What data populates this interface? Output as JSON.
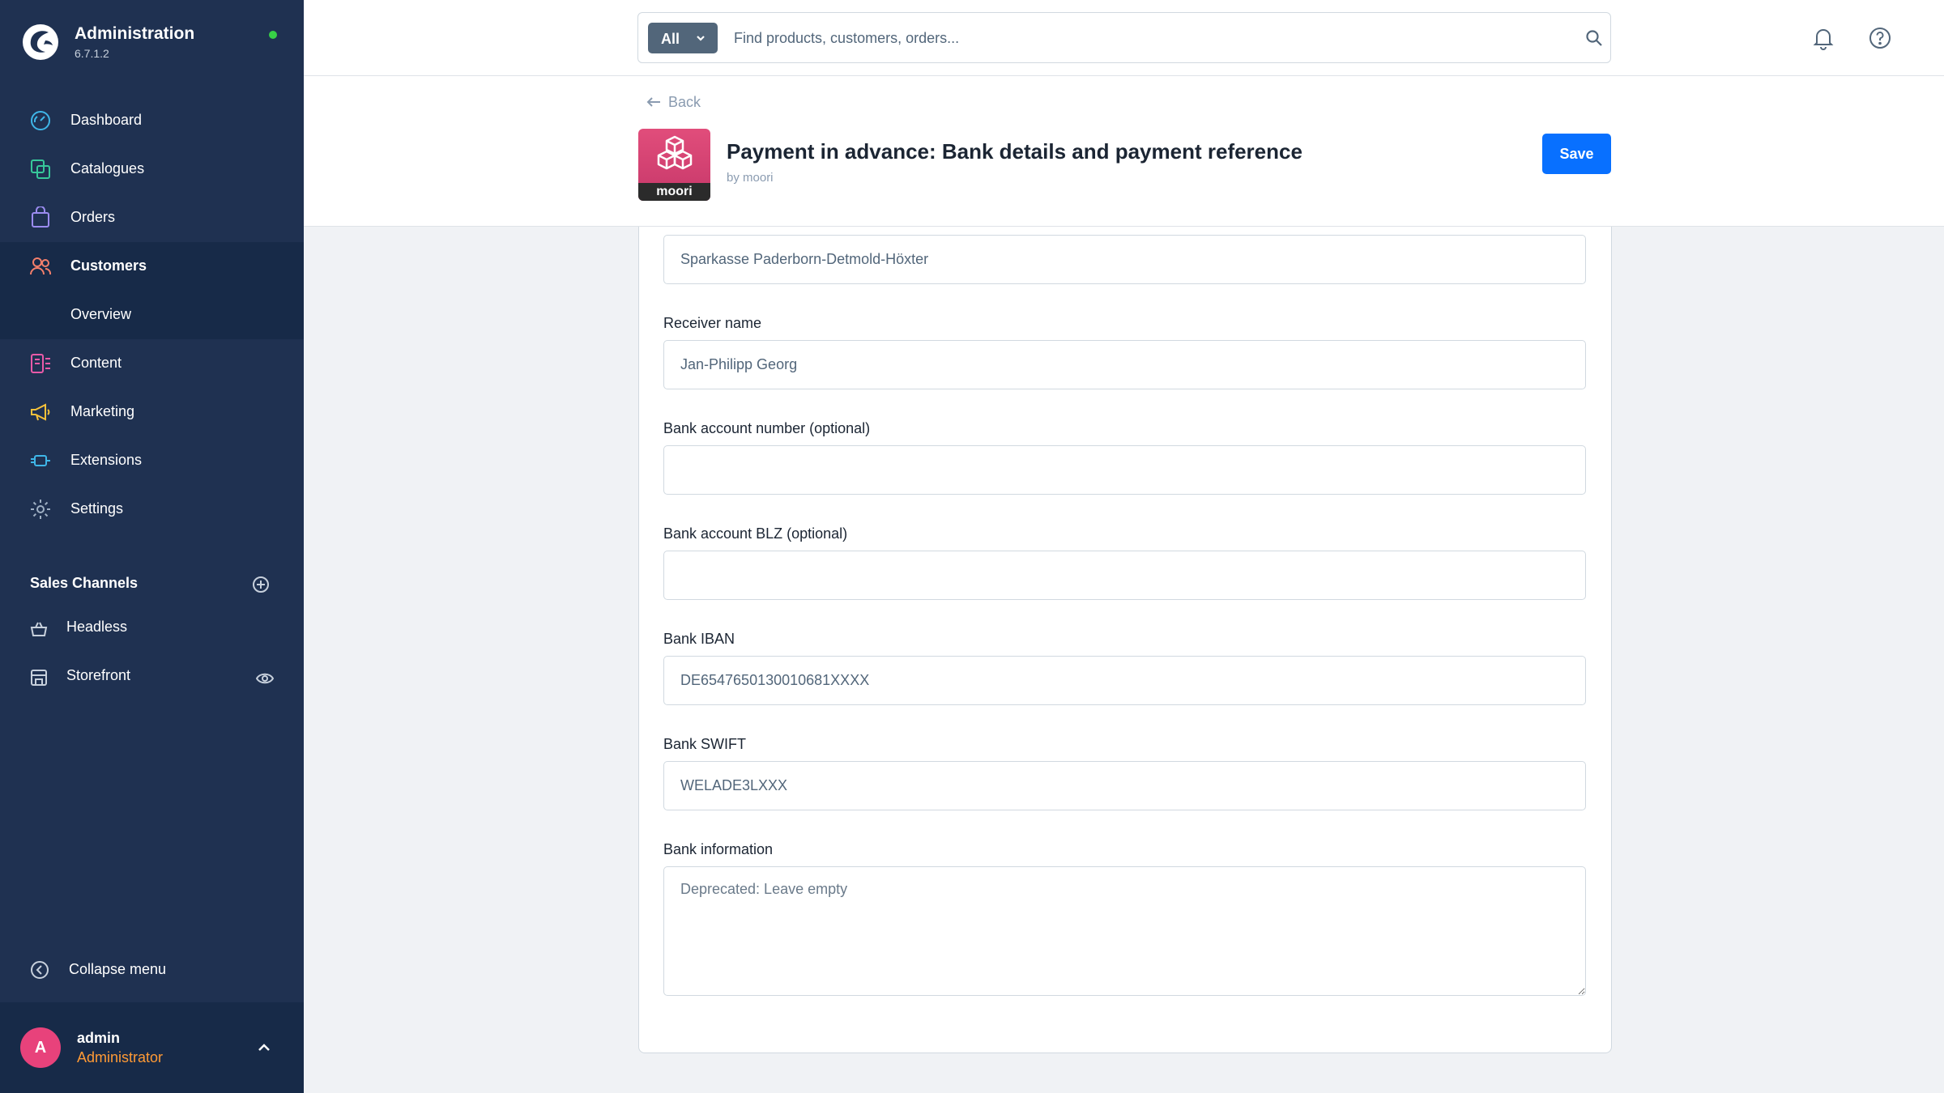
{
  "brand": {
    "title": "Administration",
    "version": "6.7.1.2"
  },
  "nav": {
    "items": [
      {
        "label": "Dashboard",
        "icon": "gauge-icon"
      },
      {
        "label": "Catalogues",
        "icon": "catalogue-icon"
      },
      {
        "label": "Orders",
        "icon": "shopping-bag-icon"
      },
      {
        "label": "Customers",
        "icon": "users-icon"
      },
      {
        "label": "Overview"
      },
      {
        "label": "Content",
        "icon": "content-icon"
      },
      {
        "label": "Marketing",
        "icon": "megaphone-icon"
      },
      {
        "label": "Extensions",
        "icon": "plug-icon"
      },
      {
        "label": "Settings",
        "icon": "gear-icon"
      }
    ],
    "active": "Customers"
  },
  "sales_channels": {
    "title": "Sales Channels",
    "items": [
      {
        "label": "Headless",
        "icon": "basket-icon"
      },
      {
        "label": "Storefront",
        "icon": "store-icon"
      }
    ]
  },
  "collapse_label": "Collapse menu",
  "user": {
    "initial": "A",
    "name": "admin",
    "role": "Administrator"
  },
  "search": {
    "type_label": "All",
    "placeholder": "Find products, customers, orders..."
  },
  "smartbar": {
    "back_label": "Back",
    "logo_text": "moori",
    "title": "Payment in advance: Bank details and payment reference",
    "subtitle": "by moori",
    "save_label": "Save"
  },
  "form": {
    "bank_name_value": "Sparkasse Paderborn-Detmold-Höxter",
    "receiver_name": {
      "label": "Receiver name",
      "value": "Jan-Philipp Georg"
    },
    "account_number": {
      "label": "Bank account number (optional)",
      "value": ""
    },
    "account_blz": {
      "label": "Bank account BLZ (optional)",
      "value": ""
    },
    "iban": {
      "label": "Bank IBAN",
      "value": "DE6547650130010681XXXX"
    },
    "swift": {
      "label": "Bank SWIFT",
      "value": "WELADE3LXXX"
    },
    "information": {
      "label": "Bank information",
      "placeholder": "Deprecated: Leave empty"
    }
  },
  "colors": {
    "sidebar": "#1f3151",
    "sidebar_active": "#172a48",
    "primary": "#0870ff",
    "status_online": "#37d046",
    "avatar": "#e8427b",
    "role_text": "#ff9a35"
  }
}
